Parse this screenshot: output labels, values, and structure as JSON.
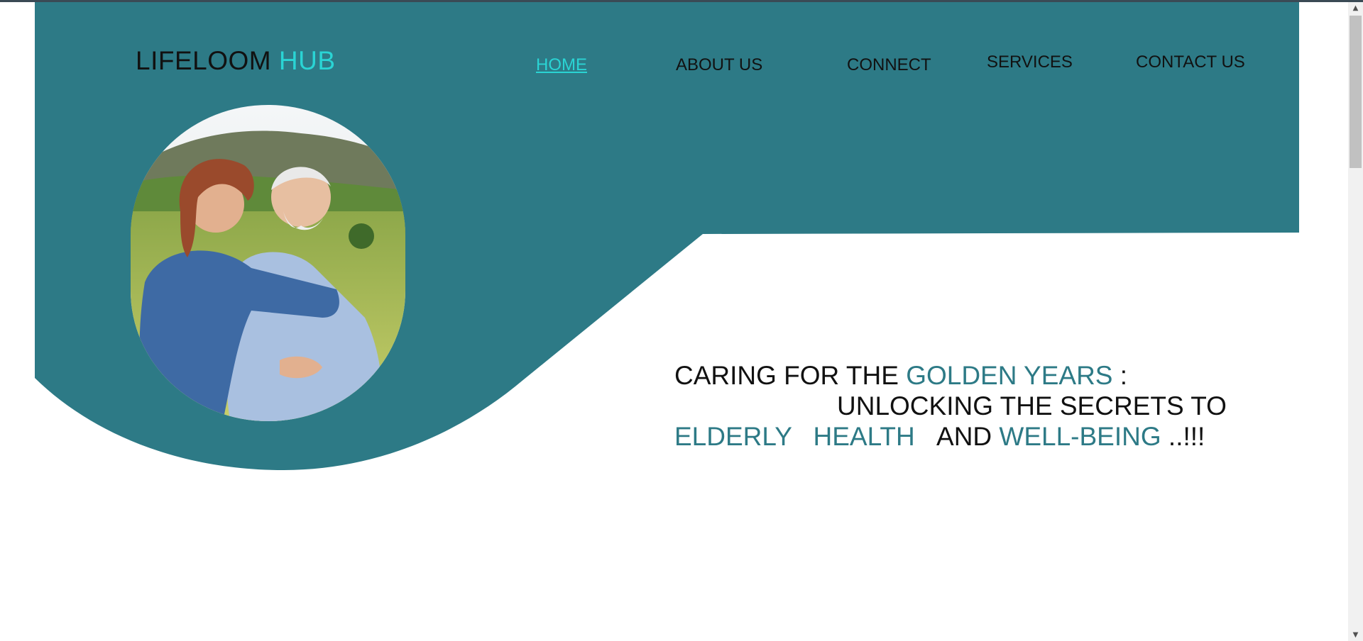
{
  "brand": {
    "name_part1": "LIFELOOM",
    "name_part2": "HUB"
  },
  "nav": {
    "items": [
      {
        "label": "HOME",
        "active": true
      },
      {
        "label": "ABOUT US",
        "active": false
      },
      {
        "label": "CONNECT",
        "active": false
      },
      {
        "label": "SERVICES",
        "active": false
      },
      {
        "label": "CONTACT US",
        "active": false
      }
    ]
  },
  "hero": {
    "image_alt": "elderly couple hugging in a meadow",
    "line1_a": "CARING FOR THE",
    "line1_b": "GOLDEN YEARS",
    "line1_c": ":",
    "line2": "UNLOCKING THE SECRETS TO",
    "line3_a": "ELDERLY",
    "line3_b": "HEALTH",
    "line3_c": "AND",
    "line3_d": "WELL-BEING",
    "line3_e": "..!!!"
  },
  "colors": {
    "primary": "#2d7a86",
    "accent": "#2ad4d4",
    "text": "#111111",
    "background": "#ffffff"
  },
  "scrollbar": {
    "up_icon": "scroll-up-arrow-icon",
    "down_icon": "scroll-down-arrow-icon"
  }
}
